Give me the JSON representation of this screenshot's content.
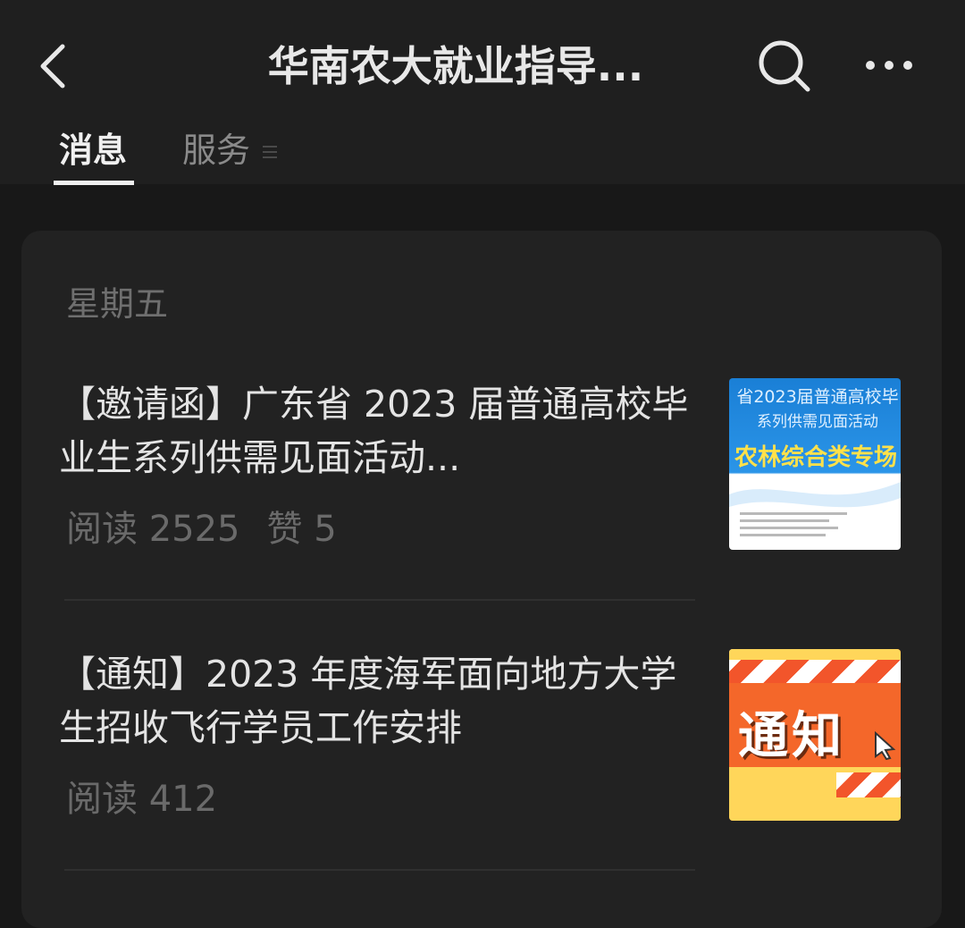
{
  "header": {
    "title": "华南农大就业指导...",
    "tabs": [
      {
        "label": "消息",
        "active": true
      },
      {
        "label": "服务",
        "active": false
      }
    ]
  },
  "date_label": "星期五",
  "articles": [
    {
      "title": "【邀请函】广东省 2023 届普通高校毕业生系列供需见面活动...",
      "reads": "阅读 2525",
      "likes": "赞 5",
      "thumbnail": {
        "line1": "省2023届普通高校毕",
        "line2": "系列供需见面活动",
        "headline": "农林综合类专场"
      }
    },
    {
      "title": "【通知】2023 年度海军面向地方大学生招收飞行学员工作安排",
      "reads": "阅读 412",
      "thumbnail": {
        "headline": "通知"
      }
    }
  ],
  "colors": {
    "background": "#181818",
    "header_bg": "#1f1f1f",
    "card_bg": "#222222",
    "text_primary": "#e4e4e4",
    "text_secondary": "#6a6a6a"
  }
}
